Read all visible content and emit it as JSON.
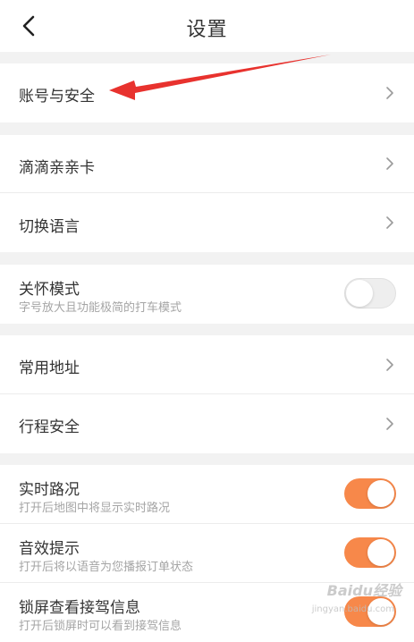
{
  "header": {
    "title": "设置",
    "back_icon": "chevron-left-icon"
  },
  "sections": {
    "account": {
      "label": "账号与安全"
    },
    "didi_card": {
      "label": "滴滴亲亲卡"
    },
    "language": {
      "label": "切换语言"
    },
    "care_mode": {
      "label": "关怀模式",
      "sub": "字号放大且功能极简的打车模式",
      "enabled": false
    },
    "common_address": {
      "label": "常用地址"
    },
    "trip_safety": {
      "label": "行程安全"
    },
    "realtime_traffic": {
      "label": "实时路况",
      "sub": "打开后地图中将显示实时路况",
      "enabled": true
    },
    "sound_prompt": {
      "label": "音效提示",
      "sub": "打开后将以语音为您播报订单状态",
      "enabled": true
    },
    "lockscreen": {
      "label": "锁屏查看接驾信息",
      "sub": "打开后锁屏时可以看到接驾信息",
      "enabled": true
    }
  },
  "colors": {
    "toggle_on": "#f7884a",
    "annotation_arrow": "#e8322e"
  },
  "watermark": {
    "text": "Baidu经验",
    "sub": "jingyan.baidu.com"
  }
}
